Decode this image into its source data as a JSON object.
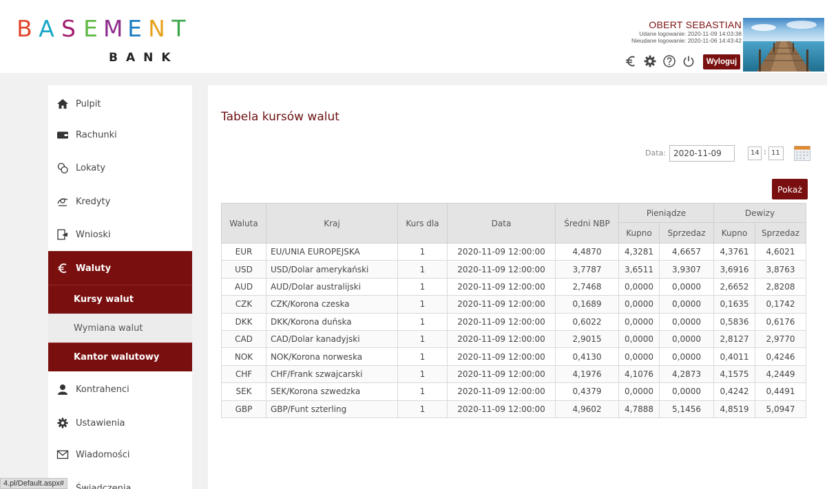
{
  "header": {
    "logo_letters": [
      {
        "ch": "B",
        "color": "#e0452c"
      },
      {
        "ch": "A",
        "color": "#18a6c8"
      },
      {
        "ch": "S",
        "color": "#a21c70"
      },
      {
        "ch": "E",
        "color": "#5db843"
      },
      {
        "ch": "M",
        "color": "#8e2b8c"
      },
      {
        "ch": "E",
        "color": "#1a7bbf"
      },
      {
        "ch": "N",
        "color": "#e6a21c"
      },
      {
        "ch": "T",
        "color": "#3aa64a"
      }
    ],
    "logo_word": "BASEMENT",
    "logo_sub": "BANK",
    "user_name": "OBERT SEBASTIAN",
    "login_ok": "Udane logowanie: 2020-11-09 14:03:38",
    "login_fail": "Nieudane logowanie: 2020-11-06 14:43:42",
    "logout_label": "Wyloguj",
    "icons": [
      "euro-icon",
      "gear-icon",
      "help-icon",
      "power-icon"
    ]
  },
  "sidebar": {
    "items": [
      {
        "label": "Pulpit",
        "icon": "home-icon"
      },
      {
        "label": "Rachunki",
        "icon": "wallet-icon"
      },
      {
        "label": "Lokaty",
        "icon": "coins-icon"
      },
      {
        "label": "Kredyty",
        "icon": "loan-icon"
      },
      {
        "label": "Wnioski",
        "icon": "form-icon"
      },
      {
        "label": "Waluty",
        "icon": "euro-icon",
        "active": true
      },
      {
        "label": "Kontrahenci",
        "icon": "person-icon"
      },
      {
        "label": "Ustawienia",
        "icon": "gear-icon"
      },
      {
        "label": "Wiadomości",
        "icon": "envelope-icon"
      },
      {
        "label": "Świadczenia",
        "icon": "benefit-icon"
      }
    ],
    "sub_items": [
      {
        "label": "Kursy walut",
        "active": true
      },
      {
        "label": "Wymiana walut",
        "active": false
      },
      {
        "label": "Kantor walutowy",
        "active": true
      }
    ]
  },
  "status_url": "4.pl/Default.aspx#",
  "main": {
    "title": "Tabela kursów walut",
    "date_label": "Data:",
    "date_value": "2020-11-09",
    "hour_value": "14",
    "time_sep": ":",
    "minute_value": "11",
    "show_button": "Pokaż",
    "table": {
      "headers": {
        "currency": "Waluta",
        "country": "Kraj",
        "rate_for": "Kurs dla",
        "date": "Data",
        "nbp_avg": "Średni NBP",
        "cash": "Pieniądze",
        "transfers": "Dewizy",
        "buy": "Kupno",
        "sell": "Sprzedaz"
      },
      "rows": [
        [
          "EUR",
          "EU/UNIA EUROPEJSKA",
          "1",
          "2020-11-09 12:00:00",
          "4,4870",
          "4,3281",
          "4,6657",
          "4,3761",
          "4,6021"
        ],
        [
          "USD",
          "USD/Dolar amerykański",
          "1",
          "2020-11-09 12:00:00",
          "3,7787",
          "3,6511",
          "3,9307",
          "3,6916",
          "3,8763"
        ],
        [
          "AUD",
          "AUD/Dolar australijski",
          "1",
          "2020-11-09 12:00:00",
          "2,7468",
          "0,0000",
          "0,0000",
          "2,6652",
          "2,8208"
        ],
        [
          "CZK",
          "CZK/Korona czeska",
          "1",
          "2020-11-09 12:00:00",
          "0,1689",
          "0,0000",
          "0,0000",
          "0,1635",
          "0,1742"
        ],
        [
          "DKK",
          "DKK/Korona duńska",
          "1",
          "2020-11-09 12:00:00",
          "0,6022",
          "0,0000",
          "0,0000",
          "0,5836",
          "0,6176"
        ],
        [
          "CAD",
          "CAD/Dolar kanadyjski",
          "1",
          "2020-11-09 12:00:00",
          "2,9015",
          "0,0000",
          "0,0000",
          "2,8127",
          "2,9770"
        ],
        [
          "NOK",
          "NOK/Korona norweska",
          "1",
          "2020-11-09 12:00:00",
          "0,4130",
          "0,0000",
          "0,0000",
          "0,4011",
          "0,4246"
        ],
        [
          "CHF",
          "CHF/Frank szwajcarski",
          "1",
          "2020-11-09 12:00:00",
          "4,1976",
          "4,1076",
          "4,2873",
          "4,1575",
          "4,2449"
        ],
        [
          "SEK",
          "SEK/Korona szwedzka",
          "1",
          "2020-11-09 12:00:00",
          "0,4379",
          "0,0000",
          "0,0000",
          "0,4242",
          "0,4491"
        ],
        [
          "GBP",
          "GBP/Funt szterling",
          "1",
          "2020-11-09 12:00:00",
          "4,9602",
          "4,7888",
          "5,1456",
          "4,8519",
          "5,0947"
        ]
      ]
    }
  },
  "colors": {
    "brand": "#7a0f0f",
    "panel": "#ffffff",
    "background": "#f1f1f1",
    "table_header": "#e4e4e4"
  }
}
